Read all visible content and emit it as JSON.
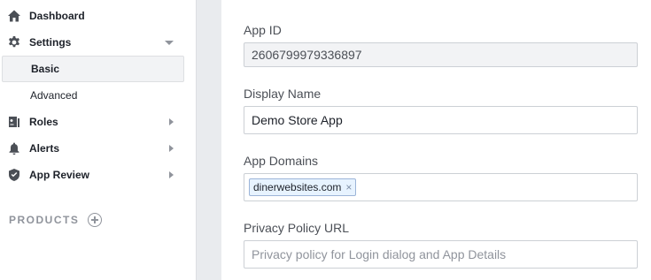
{
  "sidebar": {
    "items": [
      {
        "label": "Dashboard",
        "icon": "home-icon"
      },
      {
        "label": "Settings",
        "icon": "gear-icon",
        "expanded": true
      },
      {
        "label": "Roles",
        "icon": "roles-icon"
      },
      {
        "label": "Alerts",
        "icon": "bell-icon"
      },
      {
        "label": "App Review",
        "icon": "shield-check-icon"
      }
    ],
    "settings_subitems": [
      {
        "label": "Basic",
        "active": true
      },
      {
        "label": "Advanced",
        "active": false
      }
    ],
    "products_label": "PRODUCTS"
  },
  "form": {
    "app_id": {
      "label": "App ID",
      "value": "2606799979336897"
    },
    "display_name": {
      "label": "Display Name",
      "value": "Demo Store App"
    },
    "app_domains": {
      "label": "App Domains",
      "tokens": [
        "dinerwebsites.com"
      ],
      "remove_glyph": "×"
    },
    "privacy_policy": {
      "label": "Privacy Policy URL",
      "value": "",
      "placeholder": "Privacy policy for Login dialog and App Details"
    }
  },
  "colors": {
    "gutter": "#e9ebee",
    "border": "#dddfe2",
    "token_bg": "#e7f3ff",
    "token_border": "#9cb4d8"
  }
}
